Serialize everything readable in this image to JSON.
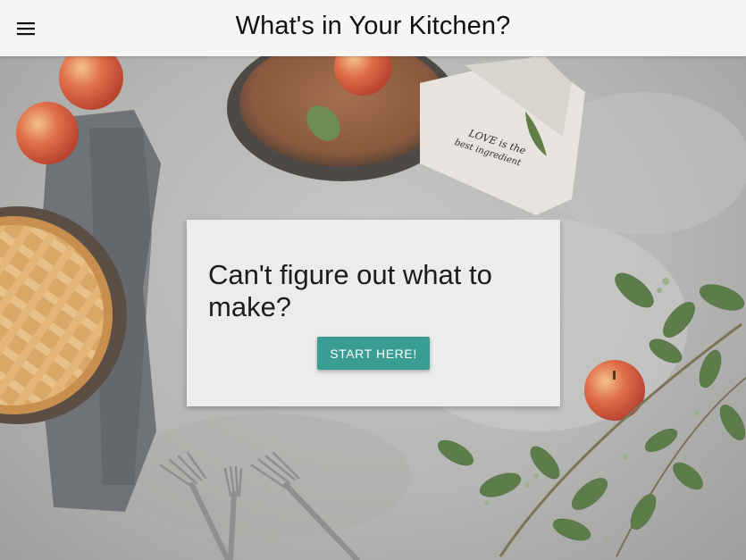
{
  "appbar": {
    "title": "What's in Your Kitchen?",
    "menu_icon": "menu-icon"
  },
  "hero": {
    "napkin_text_line1": "LOVE is the",
    "napkin_text_line2": "best ingredient"
  },
  "card": {
    "heading": "Can't figure out what to make?",
    "button_label": "START HERE!"
  },
  "colors": {
    "appbar_bg": "#f5f5f5",
    "card_bg": "#ececec",
    "button_accent": "#3a9d94"
  }
}
